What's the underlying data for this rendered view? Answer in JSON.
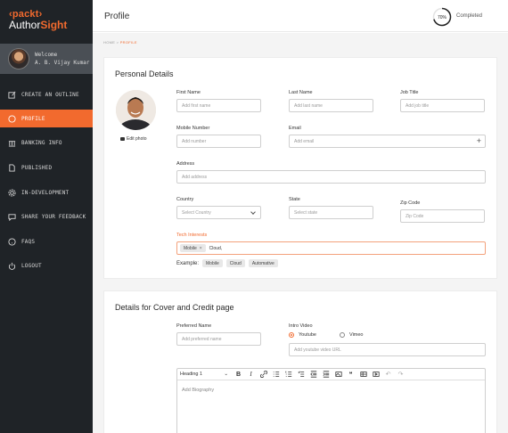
{
  "brand": {
    "line1": "‹packt›",
    "line2_prefix": "Author",
    "line2_accent": "Sight"
  },
  "user": {
    "welcome": "Welcome",
    "name": "A. B. Vijay Kumar"
  },
  "sidebar": {
    "items": [
      {
        "label": "CREATE AN OUTLINE",
        "icon": "edit-icon"
      },
      {
        "label": "PROFILE",
        "icon": "user-icon",
        "active": true
      },
      {
        "label": "BANKING INFO",
        "icon": "bank-icon"
      },
      {
        "label": "PUBLISHED",
        "icon": "document-icon"
      },
      {
        "label": "IN-DEVELOPMENT",
        "icon": "gear-icon"
      },
      {
        "label": "SHARE YOUR FEEDBACK",
        "icon": "chat-icon"
      },
      {
        "label": "FAQS",
        "icon": "help-icon"
      },
      {
        "label": "LOGOUT",
        "icon": "power-icon"
      }
    ]
  },
  "header": {
    "title": "Profile",
    "progress": {
      "percent_text": "70%",
      "value": 0.7,
      "label": "Completed"
    }
  },
  "breadcrumb": {
    "home": "HOME",
    "sep": ">",
    "current": "PROFILE"
  },
  "personal": {
    "title": "Personal Details",
    "edit_photo": "Edit photo",
    "first_name": {
      "label": "First Name",
      "placeholder": "Add first name"
    },
    "last_name": {
      "label": "Last Name",
      "placeholder": "Add last name"
    },
    "job_title": {
      "label": "Job Title",
      "placeholder": "Add job title"
    },
    "mobile": {
      "label": "Mobile Number",
      "placeholder": "Add number"
    },
    "email": {
      "label": "Email",
      "placeholder": "Add email",
      "add": "+"
    },
    "address": {
      "label": "Address",
      "placeholder": "Add address"
    },
    "country": {
      "label": "Country",
      "placeholder": "Select Country"
    },
    "state": {
      "label": "State",
      "placeholder": "Select state"
    },
    "zip": {
      "label": "Zip Code",
      "placeholder": "Zip Code"
    },
    "tech": {
      "label": "Tech Interests",
      "chip": "Mobile",
      "chip_remove": "×",
      "typed": "Cloud,"
    },
    "example": {
      "label": "Example:",
      "chips": [
        "Mobile",
        "Cloud",
        "Automative"
      ]
    }
  },
  "cover": {
    "title": "Details for Cover and Credit page",
    "preferred_name": {
      "label": "Preferred Name",
      "placeholder": "Add preferred name"
    },
    "intro_video": {
      "label": "Intro Video",
      "options": [
        "Youtube",
        "Vimeo"
      ],
      "selected": "Youtube",
      "placeholder": "Add youtube video URL"
    },
    "editor": {
      "heading": "Heading 1",
      "placeholder": "Add Biography"
    }
  },
  "colors": {
    "accent": "#f26a2e",
    "sidebar_bg": "#1f2327",
    "userbox_bg": "#4a4f55"
  }
}
